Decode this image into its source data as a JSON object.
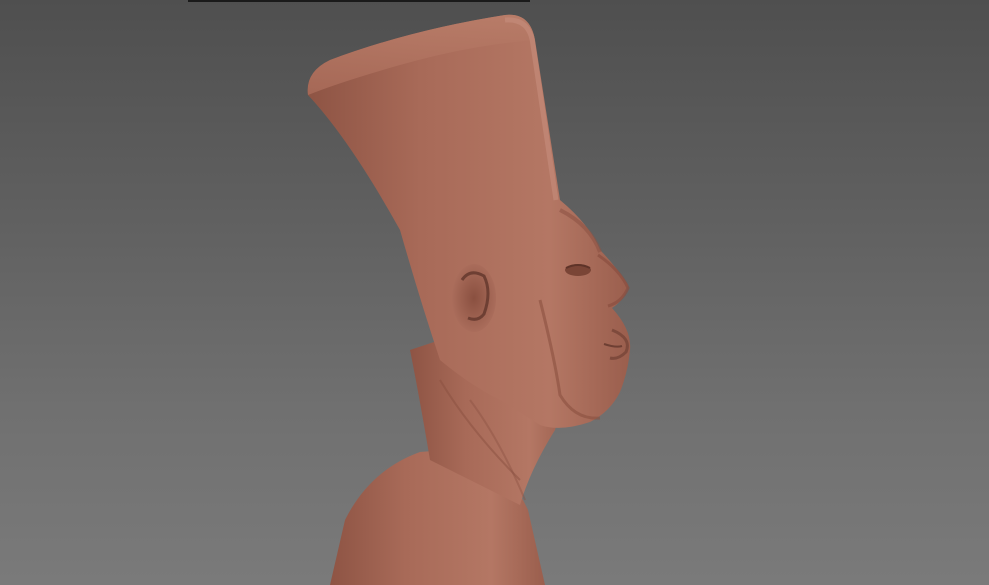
{
  "viewport": {
    "background_top": "#4f4f4f",
    "background_bottom": "#7a7a7a",
    "model_color": "#a86a58",
    "model_shadow": "#7e4a3c",
    "model_highlight": "#c48a76"
  },
  "model": {
    "icon": "sculpt-bust-icon"
  }
}
